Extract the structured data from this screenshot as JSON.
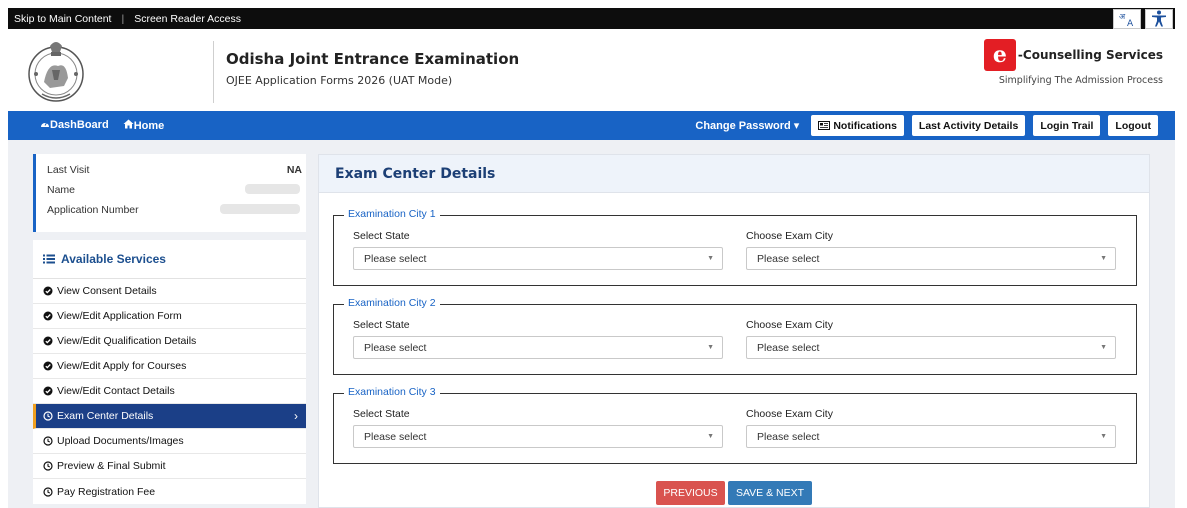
{
  "topbar": {
    "skip_link": "Skip to Main Content",
    "separator": "|",
    "screen_reader": "Screen Reader Access",
    "lang_icon": "language-icon",
    "access_icon": "accessibility-icon"
  },
  "header": {
    "title": "Odisha Joint Entrance Examination",
    "subtitle": "OJEE Application Forms 2026 (UAT Mode)",
    "ecouns_logo_letter": "e",
    "ecouns_name": "-Counselling Services",
    "ecouns_tagline": "Simplifying The Admission Process"
  },
  "nav": {
    "dashboard": "DashBoard",
    "home": "Home",
    "change_password": "Change Password",
    "notifications": "Notifications",
    "last_activity": "Last Activity Details",
    "login_trail": "Login Trail",
    "logout": "Logout"
  },
  "profile": {
    "last_visit_label": "Last Visit",
    "last_visit_value": "NA",
    "name_label": "Name",
    "app_number_label": "Application Number"
  },
  "services": {
    "heading": "Available Services",
    "items": [
      {
        "label": "View Consent Details",
        "icon": "check-circle-icon"
      },
      {
        "label": "View/Edit Application Form",
        "icon": "check-circle-icon"
      },
      {
        "label": "View/Edit Qualification Details",
        "icon": "check-circle-icon"
      },
      {
        "label": "View/Edit Apply for Courses",
        "icon": "check-circle-icon"
      },
      {
        "label": "View/Edit Contact Details",
        "icon": "check-circle-icon"
      },
      {
        "label": "Exam Center Details",
        "icon": "clock-icon"
      },
      {
        "label": "Upload Documents/Images",
        "icon": "clock-icon"
      },
      {
        "label": "Preview & Final Submit",
        "icon": "clock-icon"
      },
      {
        "label": "Pay Registration Fee",
        "icon": "clock-icon"
      }
    ]
  },
  "main": {
    "title": "Exam Center Details",
    "cities": [
      {
        "legend": "Examination City 1",
        "state_label": "Select State",
        "state_value": "Please select",
        "city_label": "Choose Exam City",
        "city_value": "Please select"
      },
      {
        "legend": "Examination City 2",
        "state_label": "Select State",
        "state_value": "Please select",
        "city_label": "Choose Exam City",
        "city_value": "Please select"
      },
      {
        "legend": "Examination City 3",
        "state_label": "Select State",
        "state_value": "Please select",
        "city_label": "Choose Exam City",
        "city_value": "Please select"
      }
    ],
    "previous": "PREVIOUS",
    "save_next": "SAVE & NEXT"
  },
  "colors": {
    "nav_blue": "#1863c5",
    "active_item": "#1b3f87",
    "previous_btn": "#d9534f",
    "next_btn": "#337ab7",
    "ecouns_red": "#e31e24"
  }
}
